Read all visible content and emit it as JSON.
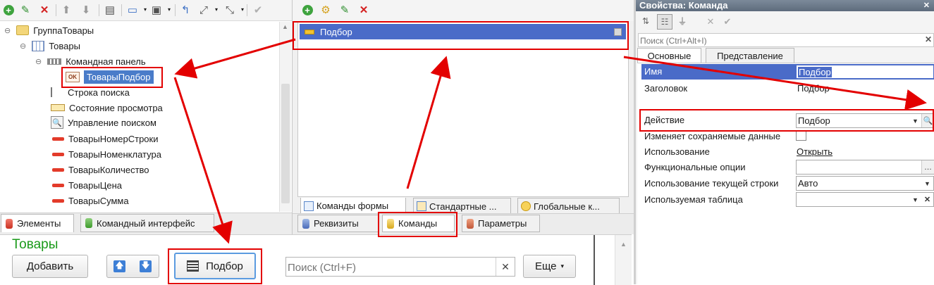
{
  "left_panel": {
    "toolbar_icons": [
      "add-icon",
      "edit-icon",
      "delete-icon",
      "move-up-icon",
      "move-down-icon",
      "form-icon",
      "view-icon",
      "layout-icon",
      "wrap-icon",
      "resize-icon",
      "expand-icon",
      "check-icon"
    ],
    "tree": [
      {
        "label": "ГруппаТовары",
        "icon": "folder-icon"
      },
      {
        "label": "Товары",
        "icon": "table-icon"
      },
      {
        "label": "Командная панель",
        "icon": "command-bar-icon"
      },
      {
        "label": "ТоварыПодбор",
        "icon": "button-ok-icon",
        "badge": "OK"
      },
      {
        "label": "Строка поиска",
        "icon": "search-string-icon"
      },
      {
        "label": "Состояние просмотра",
        "icon": "view-state-icon"
      },
      {
        "label": "Управление поиском",
        "icon": "search-icon"
      },
      {
        "label": "ТоварыНомерСтроки",
        "icon": "field-icon"
      },
      {
        "label": "ТоварыНоменклатура",
        "icon": "field-icon"
      },
      {
        "label": "ТоварыКоличество",
        "icon": "field-icon"
      },
      {
        "label": "ТоварыЦена",
        "icon": "field-icon"
      },
      {
        "label": "ТоварыСумма",
        "icon": "field-icon"
      }
    ],
    "tabs": [
      "Элементы",
      "Командный интерфейс"
    ]
  },
  "middle_panel": {
    "toolbar_icons": [
      "add-icon",
      "add-sub-icon",
      "edit-icon",
      "delete-icon"
    ],
    "command": "Подбор",
    "sub_tabs": [
      "Команды формы",
      "Стандартные ...",
      "Глобальные к..."
    ],
    "bottom_tabs": [
      "Реквизиты",
      "Команды",
      "Параметры"
    ]
  },
  "right_panel": {
    "title": "Свойства: Команда",
    "search_placeholder": "Поиск (Ctrl+Alt+I)",
    "tabs": [
      "Основные",
      "Представление"
    ],
    "properties": {
      "name_label": "Имя",
      "name_value": "Подбор",
      "title_label": "Заголовок",
      "title_value": "Подбор",
      "action_label": "Действие",
      "action_value": "Подбор",
      "modifies_label": "Изменяет сохраняемые данные",
      "usage_label": "Использование",
      "usage_value": "Открыть",
      "func_options_label": "Функциональные опции",
      "func_options_value": "",
      "current_row_label": "Использование текущей строки",
      "current_row_value": "Авто",
      "table_label": "Используемая таблица",
      "table_value": ""
    }
  },
  "preview": {
    "title": "Товары",
    "add_button": "Добавить",
    "pick_button": "Подбор",
    "search_placeholder": "Поиск (Ctrl+F)",
    "more_button": "Еще"
  },
  "colors": {
    "accent": "#4169c8",
    "highlight": "#e30000",
    "title_green": "#1a9a1a"
  }
}
